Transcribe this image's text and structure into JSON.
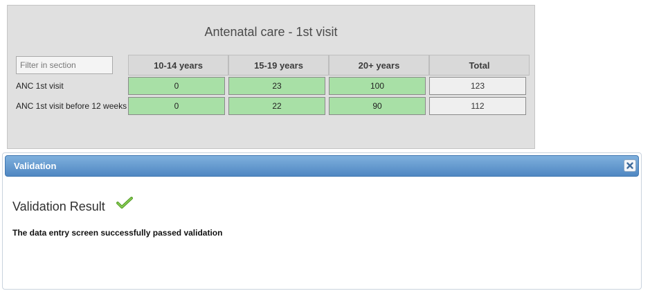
{
  "section": {
    "title": "Antenatal care - 1st visit",
    "filter_placeholder": "Filter in section",
    "columns": [
      "10-14 years",
      "15-19 years",
      "20+ years",
      "Total"
    ],
    "rows": [
      {
        "label": "ANC 1st visit",
        "values": [
          "0",
          "23",
          "100"
        ],
        "total": "123"
      },
      {
        "label": "ANC 1st visit before 12 weeks",
        "values": [
          "0",
          "22",
          "90"
        ],
        "total": "112"
      }
    ]
  },
  "dialog": {
    "title": "Validation",
    "result_title": "Validation Result",
    "result_icon": "check-icon",
    "message": "The data entry screen successfully passed validation"
  },
  "colors": {
    "valid_cell": "#a8e0a6",
    "titlebar": "#5b92c9",
    "check": "#5aa02c"
  }
}
